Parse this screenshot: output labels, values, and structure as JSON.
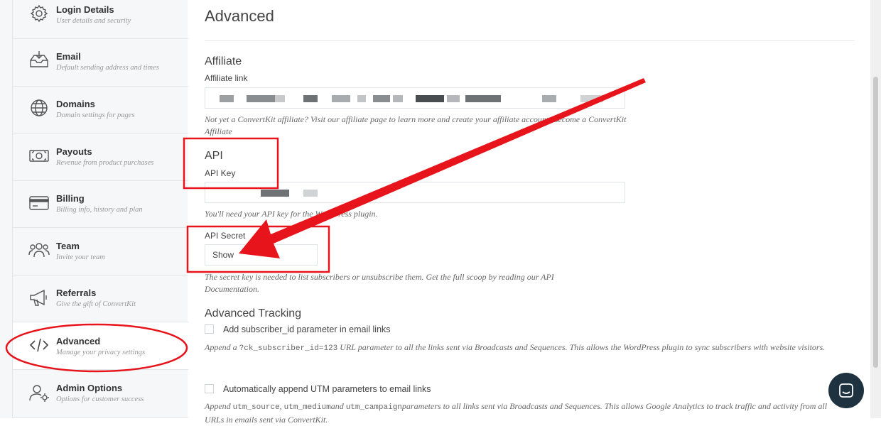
{
  "sidebar": {
    "items": [
      {
        "title": "Login Details",
        "desc": "User details and security",
        "icon": "gear-icon"
      },
      {
        "title": "Email",
        "desc": "Default sending address and times",
        "icon": "inbox-icon"
      },
      {
        "title": "Domains",
        "desc": "Domain settings for pages",
        "icon": "globe-icon"
      },
      {
        "title": "Payouts",
        "desc": "Revenue from product purchases",
        "icon": "cash-icon"
      },
      {
        "title": "Billing",
        "desc": "Billing info, history and plan",
        "icon": "credit-card-icon"
      },
      {
        "title": "Team",
        "desc": "Invite your team",
        "icon": "team-icon"
      },
      {
        "title": "Referrals",
        "desc": "Give the gift of ConvertKit",
        "icon": "megaphone-icon"
      },
      {
        "title": "Advanced",
        "desc": "Manage your privacy settings",
        "icon": "code-icon"
      },
      {
        "title": "Admin Options",
        "desc": "Options for customer success",
        "icon": "admin-user-icon"
      }
    ]
  },
  "main": {
    "title": "Advanced",
    "affiliate": {
      "heading": "Affiliate",
      "link_label": "Affiliate link",
      "help": "Not yet a ConvertKit affiliate? Visit our affiliate page to learn more and create your affiliate account. Become a ConvertKit Affiliate"
    },
    "api": {
      "heading": "API",
      "key_label": "API Key",
      "key_help": "You'll need your API key for the WordPress plugin.",
      "secret_label": "API Secret",
      "secret_button": "Show",
      "secret_help": "The secret key is needed to list subscribers or unsubscribe them. Get the full scoop by reading our API Documentation."
    },
    "tracking": {
      "heading": "Advanced Tracking",
      "subscriber_id_label": "Add subscriber_id parameter in email links",
      "subscriber_id_help_pre": "Append a ",
      "subscriber_id_help_code": "?ck_subscriber_id=123",
      "subscriber_id_help_post": " URL parameter to all the links sent via Broadcasts and Sequences. This allows the WordPress plugin to sync subscribers with website visitors.",
      "utm_label": "Automatically append UTM parameters to email links",
      "utm_help_pre": "Append ",
      "utm_help_code1": "utm_source",
      "utm_help_sep1": ", ",
      "utm_help_code2": "utm_medium",
      "utm_help_sep2": "and ",
      "utm_help_code3": "utm_campaign",
      "utm_help_post": "parameters to all links sent via Broadcasts and Sequences. This allows Google Analytics to track traffic and activity from all URLs in emails sent via ConvertKit."
    }
  },
  "colors": {
    "annotation_red": "#e8141b",
    "sidebar_bg": "#f5f7f8",
    "chat_button": "#1e3240"
  }
}
